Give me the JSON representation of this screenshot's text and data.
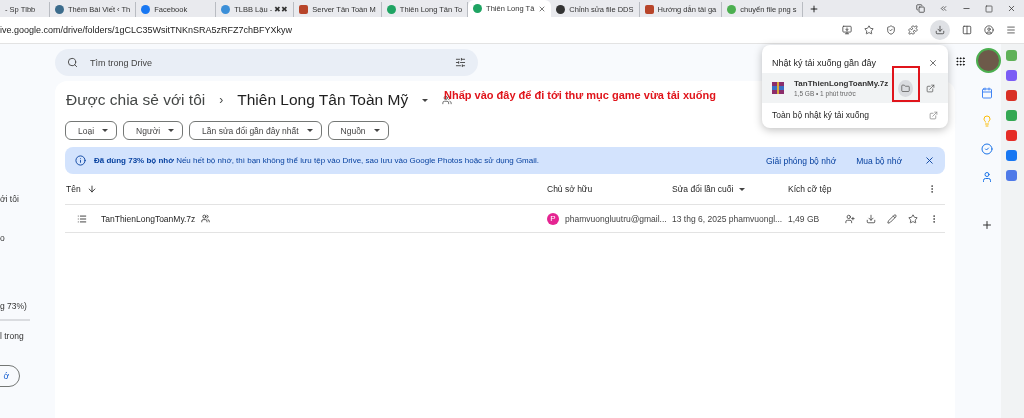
{
  "browser": {
    "tabs": [
      {
        "title": "- Sp Tlbb",
        "kind": "none",
        "selected": false
      },
      {
        "title": "Thêm Bài Viết ‹ Th",
        "kind": "wordpress",
        "selected": false
      },
      {
        "title": "Facebook",
        "kind": "facebook",
        "selected": false
      },
      {
        "title": "TLBB Lậu - ✖✖",
        "kind": "loader",
        "selected": false
      },
      {
        "title": "Server Tân Toàn M",
        "kind": "game",
        "selected": false
      },
      {
        "title": "Thiên Long Tân To",
        "kind": "drive",
        "selected": false
      },
      {
        "title": "Thiên Long Tâ",
        "kind": "drive",
        "selected": true
      },
      {
        "title": "Chỉnh sửa file DDS",
        "kind": "dark",
        "selected": false
      },
      {
        "title": "Hướng dẫn tải ga",
        "kind": "game",
        "selected": false
      },
      {
        "title": "chuyển file png s",
        "kind": "green",
        "selected": false
      }
    ],
    "address": "ive.google.com/drive/folders/1gCLC35WsitTNKnSRA5zRFZ7chBFYXkyw"
  },
  "sidebar": {
    "items": [
      "ới tôi",
      "o"
    ],
    "storage_text": "g 73%)",
    "storage_note": "l trong",
    "button": "ớ"
  },
  "search": {
    "placeholder": "Tìm trong Drive"
  },
  "breadcrumb": {
    "parent": "Được chia sẻ với tôi",
    "separator": "›",
    "current": "Thiên Long Tân Toàn Mỹ"
  },
  "annotation": "Nhấp vào đây để đi tới  thư mục game vừa tải xuống",
  "filters": [
    "Loại",
    "Người",
    "Lần sửa đổi gần đây nhất",
    "Nguồn"
  ],
  "banner": {
    "text": "**Đã dùng 73% bộ nhớ** Nếu hết bộ nhớ, thì bạn không thể lưu tệp vào Drive, sao lưu vào Google Photos hoặc sử dụng Gmail.",
    "actions": [
      "Giải phóng bộ nhớ",
      "Mua bộ nhớ"
    ]
  },
  "table": {
    "columns": [
      {
        "label": "Tên",
        "sorted": true,
        "dropdown": false
      },
      {
        "label": "Chủ sở hữu",
        "sorted": false,
        "dropdown": false
      },
      {
        "label": "Sửa đổi lần cuối",
        "sorted": false,
        "dropdown": true
      },
      {
        "label": "Kích cỡ tệp",
        "sorted": false,
        "dropdown": false
      }
    ],
    "rows": [
      {
        "name": "TanThienLongToanMy.7z",
        "shared": true,
        "owner_initial": "P",
        "owner": "phamvuongluutru@gmail...",
        "modified": "13 thg 6, 2025 phamvuongl...",
        "size": "1,49 GB"
      }
    ]
  },
  "downloads": {
    "title": "Nhật ký tải xuống gần đây",
    "items": [
      {
        "name": "TanThienLongToanMy.7z",
        "meta": "1,5 GB • 1 phút trước"
      }
    ],
    "footer": "Toàn bộ nhật ký tải xuống"
  }
}
